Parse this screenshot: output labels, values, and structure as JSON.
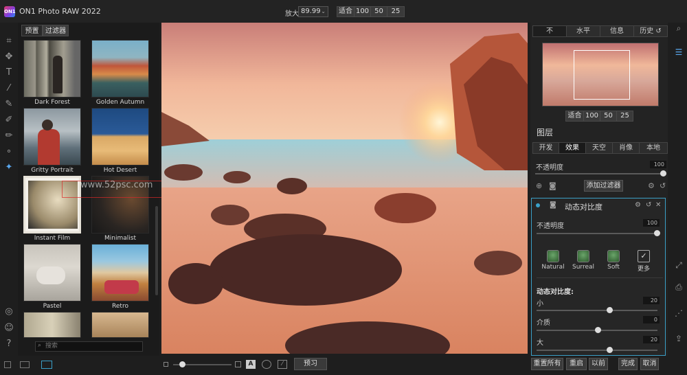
{
  "app": {
    "logo_text": "ON1",
    "title": "ON1 Photo RAW 2022"
  },
  "zoom": {
    "label": "放大",
    "value": "89.99",
    "buttons": [
      "适合",
      "100",
      "50",
      "25"
    ]
  },
  "browser": {
    "tabs": [
      "预置",
      "过滤器"
    ],
    "presets": [
      {
        "label": "Dark Forest"
      },
      {
        "label": "Golden Autumn"
      },
      {
        "label": "Gritty Portrait"
      },
      {
        "label": "Hot Desert"
      },
      {
        "label": "Instant Film"
      },
      {
        "label": "Minimalist"
      },
      {
        "label": "Pastel"
      },
      {
        "label": "Retro"
      }
    ],
    "search_placeholder": "搜索",
    "watermark": "www.52psc.com"
  },
  "right": {
    "tabs": [
      "不",
      "水平",
      "信息",
      "历史"
    ],
    "nav_zoom_buttons": [
      "适合",
      "100",
      "50",
      "25"
    ],
    "layers_title": "图层",
    "layer_tabs": [
      "开发",
      "效果",
      "天空",
      "肖像",
      "本地"
    ],
    "opacity_label": "不透明度",
    "opacity_value": "100",
    "add_filter": "添加过滤器",
    "filter": {
      "title": "动态对比度",
      "opacity_label": "不透明度",
      "opacity_value": "100",
      "presets": [
        "Natural",
        "Surreal",
        "Soft",
        "更多"
      ],
      "section_title": "动态对比度:",
      "sliders": [
        {
          "label": "小",
          "value": "20"
        },
        {
          "label": "介质",
          "value": "0"
        },
        {
          "label": "大",
          "value": "20"
        }
      ]
    }
  },
  "bottom": {
    "preview": "预习",
    "reset_all": "重置所有",
    "reset": "重启",
    "previous": "以前",
    "done": "完成",
    "cancel": "取消"
  }
}
